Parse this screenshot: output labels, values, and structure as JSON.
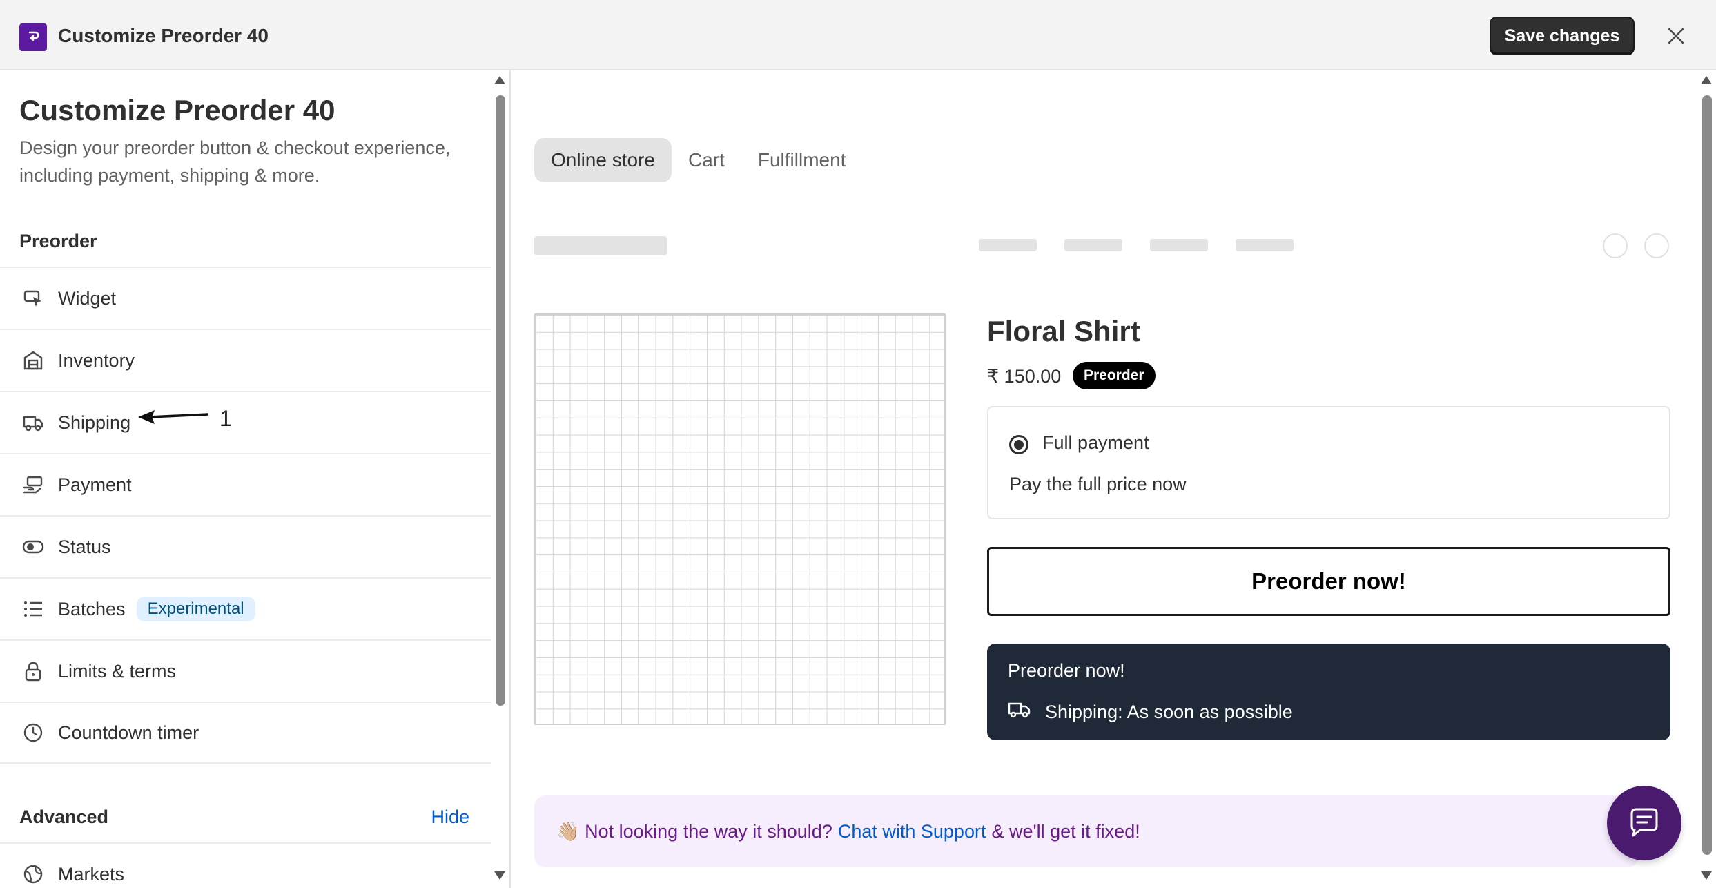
{
  "header": {
    "title": "Customize Preorder 40",
    "save_label": "Save changes"
  },
  "sidebar": {
    "title": "Customize Preorder 40",
    "description": "Design your preorder button & checkout experience, including payment, shipping & more.",
    "section_preorder": "Preorder",
    "items": [
      {
        "label": "Widget",
        "icon": "cursor-pointer-icon"
      },
      {
        "label": "Inventory",
        "icon": "warehouse-icon"
      },
      {
        "label": "Shipping",
        "icon": "truck-icon"
      },
      {
        "label": "Payment",
        "icon": "hand-cash-icon"
      },
      {
        "label": "Status",
        "icon": "toggle-icon"
      },
      {
        "label": "Batches",
        "icon": "list-icon",
        "badge": "Experimental"
      },
      {
        "label": "Limits & terms",
        "icon": "lock-icon"
      },
      {
        "label": "Countdown timer",
        "icon": "clock-icon"
      }
    ],
    "section_advanced": "Advanced",
    "hide_label": "Hide",
    "advanced_items": [
      {
        "label": "Markets",
        "icon": "globe-icon"
      }
    ],
    "annotation_number": "1"
  },
  "main": {
    "tabs": [
      {
        "label": "Online store",
        "active": true
      },
      {
        "label": "Cart",
        "active": false
      },
      {
        "label": "Fulfillment",
        "active": false
      }
    ],
    "product": {
      "title": "Floral Shirt",
      "price": "₹ 150.00",
      "badge": "Preorder",
      "payment_option": "Full payment",
      "payment_sub": "Pay the full price now",
      "button_label": "Preorder now!",
      "info_title": "Preorder now!",
      "info_shipping": "Shipping: As soon as possible"
    },
    "support": {
      "prefix": "👋🏼 Not looking the way it should?",
      "link": "Chat with Support",
      "suffix": "& we'll get it fixed!"
    }
  },
  "colors": {
    "accent_purple": "#5b1aa0",
    "link_blue": "#005bd3",
    "dark_panel": "#1f2937",
    "badge_bg": "#e0f0ff"
  }
}
